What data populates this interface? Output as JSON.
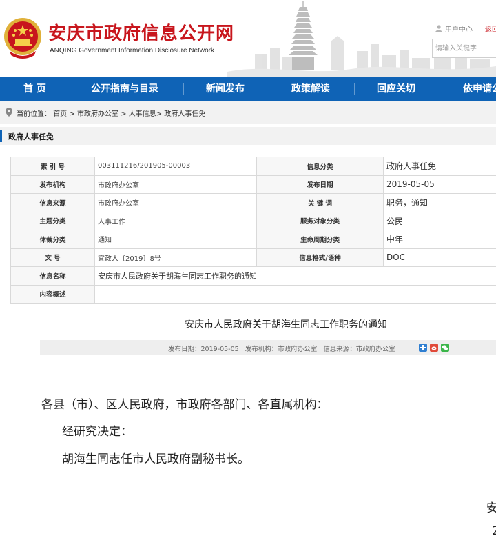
{
  "header": {
    "site_title_cn": "安庆市政府信息公开网",
    "site_title_en": "ANQING Government Information Disclosure Network",
    "user_center": "用户中心",
    "back_link": "返回",
    "search_placeholder": "请输入关键字",
    "emblem_icon": "national-emblem-icon",
    "brand_red": "#c8161d"
  },
  "nav": {
    "color": "#0f63b6",
    "items": [
      "首 页",
      "公开指南与目录",
      "新闻发布",
      "政策解读",
      "回应关切",
      "依申请公开"
    ]
  },
  "breadcrumb": {
    "prefix": "当前位置：",
    "items": [
      "首页",
      "市政府办公室",
      "人事信息",
      "政府人事任免"
    ]
  },
  "section_title": "政府人事任免",
  "info_table": {
    "rows": [
      {
        "label1": "索 引 号",
        "value1": "003111216/201905-00003",
        "label2": "信息分类",
        "value2": "政府人事任免"
      },
      {
        "label1": "发布机构",
        "value1": "市政府办公室",
        "label2": "发布日期",
        "value2": "2019-05-05"
      },
      {
        "label1": "信息来源",
        "value1": "市政府办公室",
        "label2": "关 键 词",
        "value2": "职务，通知"
      },
      {
        "label1": "主题分类",
        "value1": "人事工作",
        "label2": "服务对象分类",
        "value2": "公民"
      },
      {
        "label1": "体裁分类",
        "value1": "通知",
        "label2": "生命周期分类",
        "value2": "中年"
      },
      {
        "label1": "文 号",
        "value1": "宜政人〔2019〕8号",
        "label2": "信息格式/语种",
        "value2": "DOC"
      }
    ],
    "name_label": "信息名称",
    "name_value": "安庆市人民政府关于胡海生同志工作职务的通知",
    "summary_label": "内容概述",
    "summary_value": ""
  },
  "article": {
    "title": "安庆市人民政府关于胡海生同志工作职务的通知",
    "meta": {
      "date_label": "发布日期：",
      "date": "2019-05-05",
      "org_label": "发布机构：",
      "org": "市政府办公室",
      "source_label": "信息来源：",
      "source": "市政府办公室"
    },
    "share_icons": [
      "share-plus-icon",
      "weibo-icon",
      "wechat-icon"
    ],
    "paragraphs": [
      "各县（市）、区人民政府，市政府各部门、各直属机构：",
      "经研究决定：",
      "胡海生同志任市人民政府副秘书长。"
    ],
    "signature_org": "安",
    "signature_date": "2"
  }
}
